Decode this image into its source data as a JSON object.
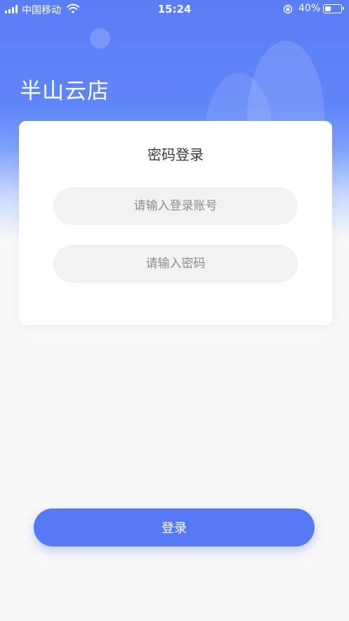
{
  "status_bar": {
    "carrier": "中国移动",
    "time": "15:24",
    "battery_percent": "40%",
    "battery_level": 0.4
  },
  "brand": {
    "title": "半山云店"
  },
  "login_card": {
    "title": "密码登录",
    "account_placeholder": "请输入登录账号",
    "password_placeholder": "请输入密码"
  },
  "actions": {
    "login_label": "登录"
  },
  "colors": {
    "accent": "#5679f5",
    "hero_top": "#5a7ef7",
    "background": "#f8f8f9"
  },
  "icons": [
    "signal-icon",
    "wifi-icon",
    "rotation-lock-icon",
    "battery-icon"
  ]
}
